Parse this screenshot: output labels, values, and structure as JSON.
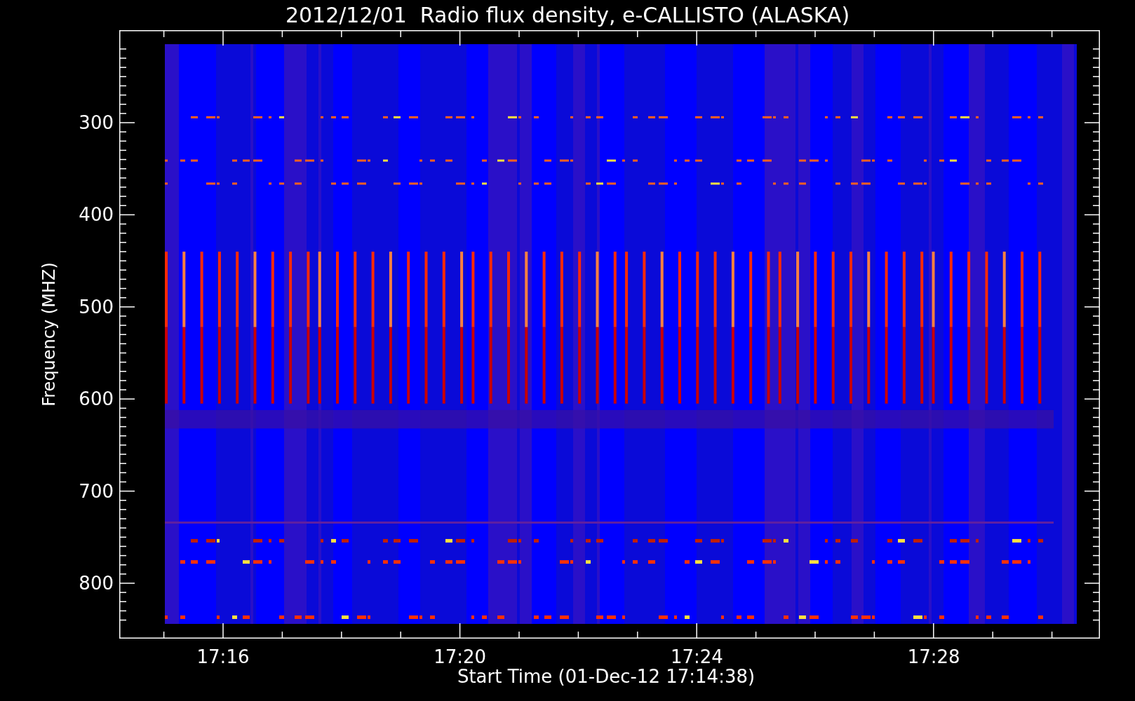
{
  "chart": {
    "title": "2012/12/01  Radio flux density, e-CALLISTO (ALASKA)",
    "y_axis": {
      "label": "Frequency (MHZ)",
      "ticks": [
        "300",
        "400",
        "500",
        "600",
        "700",
        "800"
      ]
    },
    "x_axis": {
      "label": "Start Time (01-Dec-12 17:14:38)",
      "ticks": [
        "17:16",
        "17:20",
        "17:24",
        "17:28"
      ]
    }
  }
}
